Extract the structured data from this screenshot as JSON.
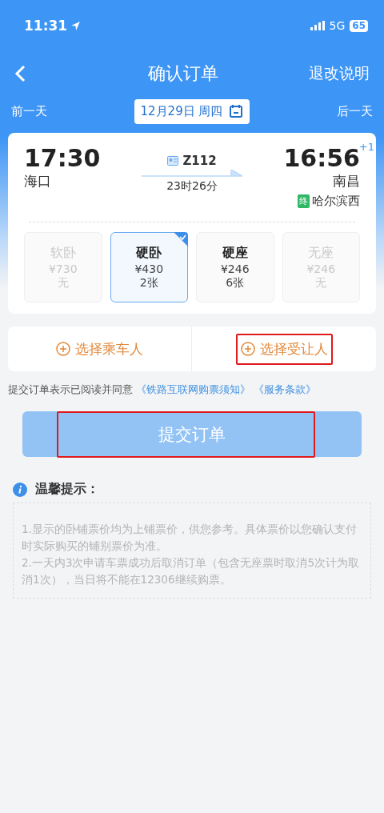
{
  "status_bar": {
    "time": "11:31",
    "network": "5G",
    "battery": "65"
  },
  "nav": {
    "title": "确认订单",
    "action": "退改说明"
  },
  "date_bar": {
    "prev": "前一天",
    "date": "12月29日 周四",
    "next": "后一天"
  },
  "train": {
    "depart_time": "17:30",
    "depart_station": "海口",
    "number": "Z112",
    "duration": "23时26分",
    "arrive_time": "16:56",
    "day_offset": "+1",
    "arrive_station": "南昌",
    "terminal_badge": "终",
    "terminal": "哈尔滨西"
  },
  "seats": [
    {
      "name": "软卧",
      "price": "¥730",
      "count": "无",
      "selected": false,
      "disabled": true
    },
    {
      "name": "硬卧",
      "price": "¥430",
      "count": "2张",
      "selected": true,
      "disabled": false
    },
    {
      "name": "硬座",
      "price": "¥246",
      "count": "6张",
      "selected": false,
      "disabled": false
    },
    {
      "name": "无座",
      "price": "¥246",
      "count": "无",
      "selected": false,
      "disabled": true
    }
  ],
  "passenger_buttons": [
    {
      "label": "选择乘车人",
      "annotated": false
    },
    {
      "label": "选择受让人",
      "annotated": true
    }
  ],
  "agreement": {
    "text": "提交订单表示已阅读并同意",
    "links": [
      "《铁路互联网购票须知》",
      "《服务条款》"
    ]
  },
  "submit": {
    "label": "提交订单",
    "annotated": true
  },
  "tips": {
    "title": "温馨提示：",
    "items": [
      "1.显示的卧铺票价均为上铺票价，供您参考。具体票价以您确认支付时实际购买的铺别票价为准。",
      "2.一天内3次申请车票成功后取消订单（包含无座票时取消5次计为取消1次），当日将不能在12306继续购票。"
    ]
  }
}
